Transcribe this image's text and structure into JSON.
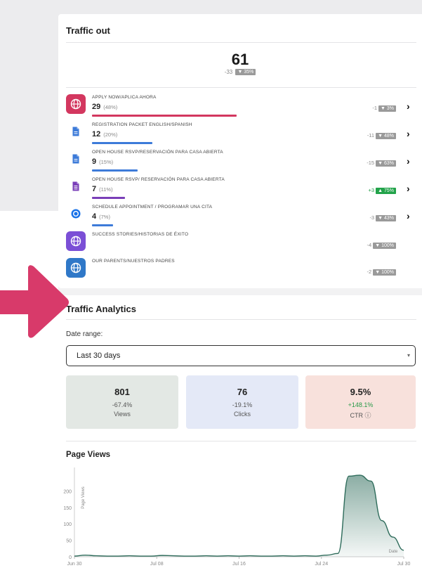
{
  "traffic_out": {
    "title": "Traffic out",
    "total": "61",
    "total_delta": "-33",
    "total_pct": "▼ 35%",
    "items": [
      {
        "label": "APPLY NOW/APLICA AHORA",
        "count": "29",
        "pct": "(48%)",
        "delta": "-1",
        "delta_pct": "▼ 3%",
        "icon": "globe-icon",
        "icon_bg": "#d3375f",
        "bar_color": "#d3375f",
        "bar_fraction": 0.48,
        "direction": "down",
        "has_link": true
      },
      {
        "label": "REGISTRATION PACKET ENGLISH/SPANISH",
        "count": "12",
        "pct": "(20%)",
        "delta": "-11",
        "delta_pct": "▼ 48%",
        "icon": "document-icon",
        "icon_bg": "#ffffff",
        "bar_color": "#3d7bd9",
        "bar_fraction": 0.2,
        "direction": "down",
        "has_link": true
      },
      {
        "label": "OPEN HOUSE RSVP/RESERVACIÓN PARA CASA ABIERTA",
        "count": "9",
        "pct": "(15%)",
        "delta": "-15",
        "delta_pct": "▼ 63%",
        "icon": "document-icon",
        "icon_bg": "#ffffff",
        "bar_color": "#3d7bd9",
        "bar_fraction": 0.15,
        "direction": "down",
        "has_link": true
      },
      {
        "label": "OPEN HOUSE RSVP/ RESERVACIÓN PARA CASA ABIERTA",
        "count": "7",
        "pct": "(11%)",
        "delta": "+3",
        "delta_pct": "▲ 75%",
        "icon": "form-icon",
        "icon_bg": "#ffffff",
        "bar_color": "#7a3fb8",
        "bar_fraction": 0.11,
        "direction": "up",
        "has_link": true
      },
      {
        "label": "SCHEDULE APPOINTMENT / PROGRAMAR UNA CITA",
        "count": "4",
        "pct": "(7%)",
        "delta": "-3",
        "delta_pct": "▼ 43%",
        "icon": "calendar-icon",
        "icon_bg": "#ffffff",
        "bar_color": "#3d7bd9",
        "bar_fraction": 0.07,
        "direction": "down",
        "has_link": true
      },
      {
        "label": "SUCCESS STORIES/HISTORIAS DE ÉXITO",
        "count": "",
        "pct": "",
        "delta": "-4",
        "delta_pct": "▼ 100%",
        "icon": "globe-icon",
        "icon_bg": "#7b4fd6",
        "bar_color": "#7b4fd6",
        "bar_fraction": 0,
        "direction": "down",
        "has_link": false
      },
      {
        "label": "OUR PARENTS/NUESTROS PADRES",
        "count": "",
        "pct": "",
        "delta": "-2",
        "delta_pct": "▼ 100%",
        "icon": "globe-icon",
        "icon_bg": "#2f78c8",
        "bar_color": "#2f78c8",
        "bar_fraction": 0,
        "direction": "down",
        "has_link": false
      }
    ]
  },
  "analytics": {
    "title": "Traffic Analytics",
    "date_range_label": "Date range:",
    "date_range_value": "Last 30 days",
    "stats": [
      {
        "value": "801",
        "change": "-67.4%",
        "label": "Views",
        "bg": "#e3e8e4",
        "positive": false
      },
      {
        "value": "76",
        "change": "-19.1%",
        "label": "Clicks",
        "bg": "#e4e9f7",
        "positive": false
      },
      {
        "value": "9.5%",
        "change": "+148.1%",
        "label": "CTR ⓘ",
        "bg": "#f8e1dc",
        "positive": true
      }
    ],
    "page_views_title": "Page Views"
  },
  "colors": {
    "accent_arrow": "#d83a6a",
    "chart_line": "#2d6b5a"
  },
  "chart_data": {
    "type": "area",
    "title": "Page Views",
    "ylabel": "Page Views",
    "xlabel": "Date",
    "ylim": [
      0,
      250
    ],
    "yticks": [
      0,
      50,
      100,
      150,
      200
    ],
    "xticks": [
      "Jun 30",
      "Jul 08",
      "Jul 16",
      "Jul 24",
      "Jul 30"
    ],
    "x": [
      0,
      1,
      2,
      3,
      4,
      5,
      6,
      7,
      8,
      9,
      10,
      11,
      12,
      13,
      14,
      15,
      16,
      17,
      18,
      19,
      20,
      21,
      22,
      23,
      24,
      25,
      26,
      27,
      28,
      29,
      30
    ],
    "values": [
      2,
      5,
      3,
      2,
      2,
      3,
      2,
      2,
      4,
      3,
      2,
      2,
      3,
      2,
      3,
      2,
      3,
      2,
      2,
      3,
      2,
      3,
      2,
      5,
      10,
      245,
      248,
      230,
      110,
      60,
      20
    ],
    "grid": false,
    "legend": "none"
  }
}
